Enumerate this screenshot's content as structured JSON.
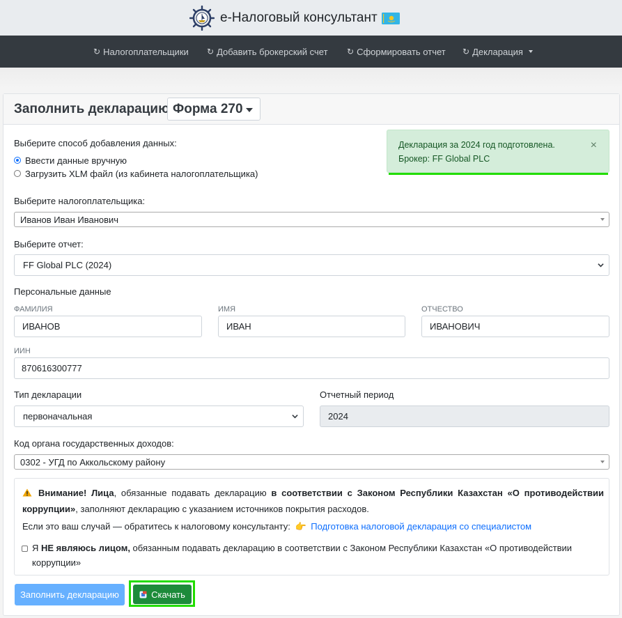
{
  "app": {
    "title": "e-Налоговый консультант"
  },
  "nav": {
    "items": [
      {
        "label": "Налогоплательщики",
        "icon": "refresh-icon"
      },
      {
        "label": "Добавить брокерский счет",
        "icon": "refresh-icon"
      },
      {
        "label": "Сформировать отчет",
        "icon": "refresh-icon"
      },
      {
        "label": "Декларация",
        "icon": "refresh-icon",
        "dropdown": true
      }
    ]
  },
  "card": {
    "title": "Заполнить декларацию",
    "form_select": "Форма 270"
  },
  "method": {
    "label": "Выберите способ добавления данных:",
    "options": [
      {
        "label": "Ввести данные вручную",
        "checked": true
      },
      {
        "label": "Загрузить XLM файл (из кабинета налогоплательщика)",
        "checked": false
      }
    ]
  },
  "alert": {
    "line1": "Декларация за 2024 год подготовлена.",
    "line2": "Брокер: FF Global PLC",
    "close": "×",
    "color": "#d4edda"
  },
  "taxpayer": {
    "label": "Выберите налогоплательщика:",
    "value": "Иванов Иван Иванович"
  },
  "report": {
    "label": "Выберите отчет:",
    "value": "FF Global PLC (2024)"
  },
  "personal": {
    "heading": "Персональные данные",
    "surname_label": "ФАМИЛИЯ",
    "surname": "ИВАНОВ",
    "name_label": "ИМЯ",
    "name": "ИВАН",
    "patronymic_label": "ОТЧЕСТВО",
    "patronymic": "ИВАНОВИЧ",
    "iin_label": "ИИН",
    "iin": "870616300777"
  },
  "declaration": {
    "type_label": "Тип декларации",
    "type_value": "первоначальная",
    "period_label": "Отчетный период",
    "period_value": "2024"
  },
  "authority": {
    "label": "Код органа государственных доходов:",
    "value": "0302 - УГД по Аккольскому району"
  },
  "warning": {
    "attention": "Внимание!",
    "subject": "Лица",
    "text1": ", обязанные подавать декларацию ",
    "law": "в соответствии с Законом Республики Казахстан «О противодействии коррупции»",
    "text2": ", заполняют декларацию с указанием источников покрытия расходов.",
    "contact_text": "Если это ваш случай — обратитесь к налоговому консультанту:",
    "link": "Подготовка налоговой декларация со специалистом",
    "checkbox_prefix": "Я ",
    "checkbox_bold": "НЕ являюсь лицом,",
    "checkbox_rest": " обязанным подавать декларацию в соответствии с Законом Республики Казахстан «О противодействии коррупции»"
  },
  "buttons": {
    "fill": "Заполнить декларацию",
    "download": "Скачать"
  }
}
